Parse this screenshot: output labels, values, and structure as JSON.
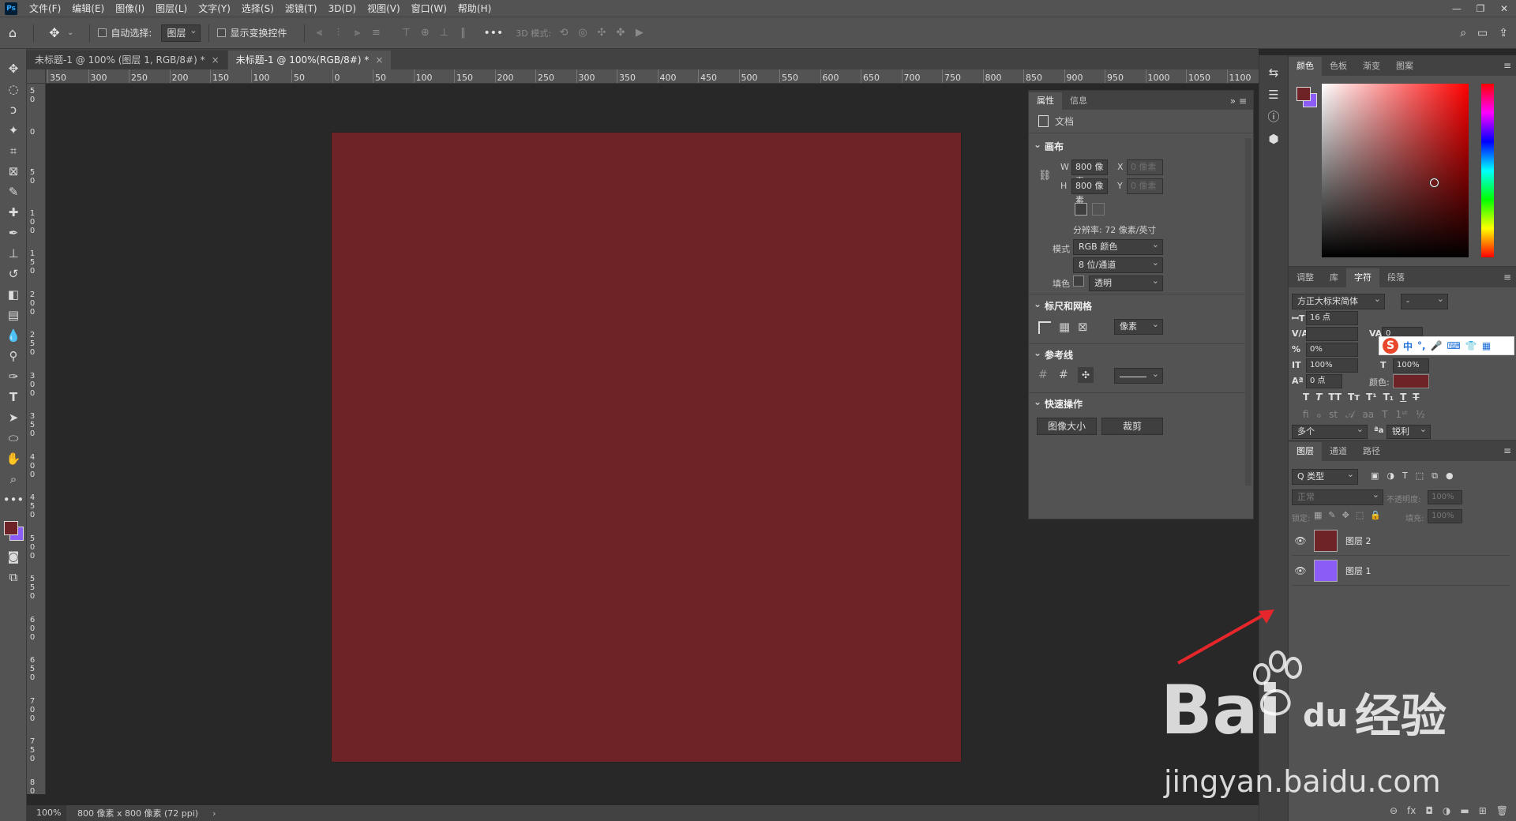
{
  "app": {
    "logo_text": "Ps"
  },
  "menu": [
    "文件(F)",
    "编辑(E)",
    "图像(I)",
    "图层(L)",
    "文字(Y)",
    "选择(S)",
    "滤镜(T)",
    "3D(D)",
    "视图(V)",
    "窗口(W)",
    "帮助(H)"
  ],
  "window_controls": [
    "—",
    "❐",
    "✕"
  ],
  "options_bar": {
    "auto_select_label": "自动选择:",
    "auto_select_value": "图层",
    "transform_label": "显示变换控件",
    "mode_3d_label": "3D 模式:",
    "more": "•••"
  },
  "tabs": [
    {
      "label": "未标题-1 @ 100% (图层 1, RGB/8#) *",
      "close": "×"
    },
    {
      "label": "未标题-1 @ 100%(RGB/8#) *",
      "close": "×"
    }
  ],
  "ruler_h": [
    "350",
    "300",
    "250",
    "200",
    "150",
    "100",
    "50",
    "0",
    "50",
    "100",
    "150",
    "200",
    "250",
    "300",
    "350",
    "400",
    "450",
    "500",
    "550",
    "600",
    "650",
    "700",
    "750",
    "800",
    "850",
    "900",
    "950",
    "1000",
    "1050",
    "1100",
    "1"
  ],
  "ruler_v": [
    "50",
    "0",
    "50",
    "100",
    "150",
    "200",
    "250",
    "300",
    "350",
    "400",
    "450",
    "500",
    "550",
    "600",
    "650",
    "700",
    "750",
    "800",
    "850"
  ],
  "status": {
    "zoom": "100%",
    "info": "800 像素 x 800 像素 (72 ppi)",
    "arrow": "›"
  },
  "properties": {
    "tabs": [
      "属性",
      "信息"
    ],
    "doc_label": "文档",
    "canvas_header": "画布",
    "w_label": "W",
    "w_value": "800 像素",
    "h_label": "H",
    "h_value": "800 像素",
    "x_label": "X",
    "x_placeholder": "0 像素",
    "y_label": "Y",
    "y_placeholder": "0 像素",
    "resolution": "分辨率: 72 像素/英寸",
    "mode_label": "模式",
    "mode_value": "RGB 颜色",
    "depth_value": "8 位/通道",
    "fill_label": "填色",
    "fill_value": "透明",
    "rulers_header": "标尺和网格",
    "units_value": "像素",
    "guides_header": "参考线",
    "quick_header": "快速操作",
    "btn_image_size": "图像大小",
    "btn_crop": "裁剪"
  },
  "color_panel": {
    "tabs": [
      "颜色",
      "色板",
      "渐变",
      "图案"
    ],
    "fg": "#6e2427",
    "bg": "#8b5cf6",
    "menu": "≡"
  },
  "char_panel": {
    "tabs": [
      "调整",
      "库",
      "字符",
      "段落"
    ],
    "font_family": "方正大标宋简体",
    "font_style": "-",
    "size": "16 点",
    "tracking": "0",
    "scale_pct": "0%",
    "vscale": "100%",
    "hscale": "100%",
    "baseline": "0 点",
    "color_label": "颜色:",
    "lang": "多个",
    "aa_label": "ªa",
    "aa_value": "锐利"
  },
  "ime": {
    "s": "S",
    "items": [
      "中",
      "°,",
      "🎤",
      "⌨",
      "👕",
      "▦"
    ]
  },
  "layers_panel": {
    "tabs": [
      "图层",
      "通道",
      "路径"
    ],
    "filter_value": "Q 类型",
    "blend_value": "正常",
    "opacity_label": "不透明度:",
    "opacity_value": "100%",
    "lock_label": "锁定:",
    "fill_label": "填充:",
    "fill_value": "100%",
    "layers": [
      {
        "name": "图层 2",
        "color": "#6e2427"
      },
      {
        "name": "图层 1",
        "color": "#8b5cf6"
      }
    ],
    "bottom_icons": [
      "⊖",
      "fx",
      "◘",
      "◑",
      "▬",
      "⊞",
      "🗑"
    ]
  },
  "watermark": {
    "brand": "Bai",
    "du": "du",
    "cn": "经验",
    "url": "jingyan.baidu.com"
  }
}
